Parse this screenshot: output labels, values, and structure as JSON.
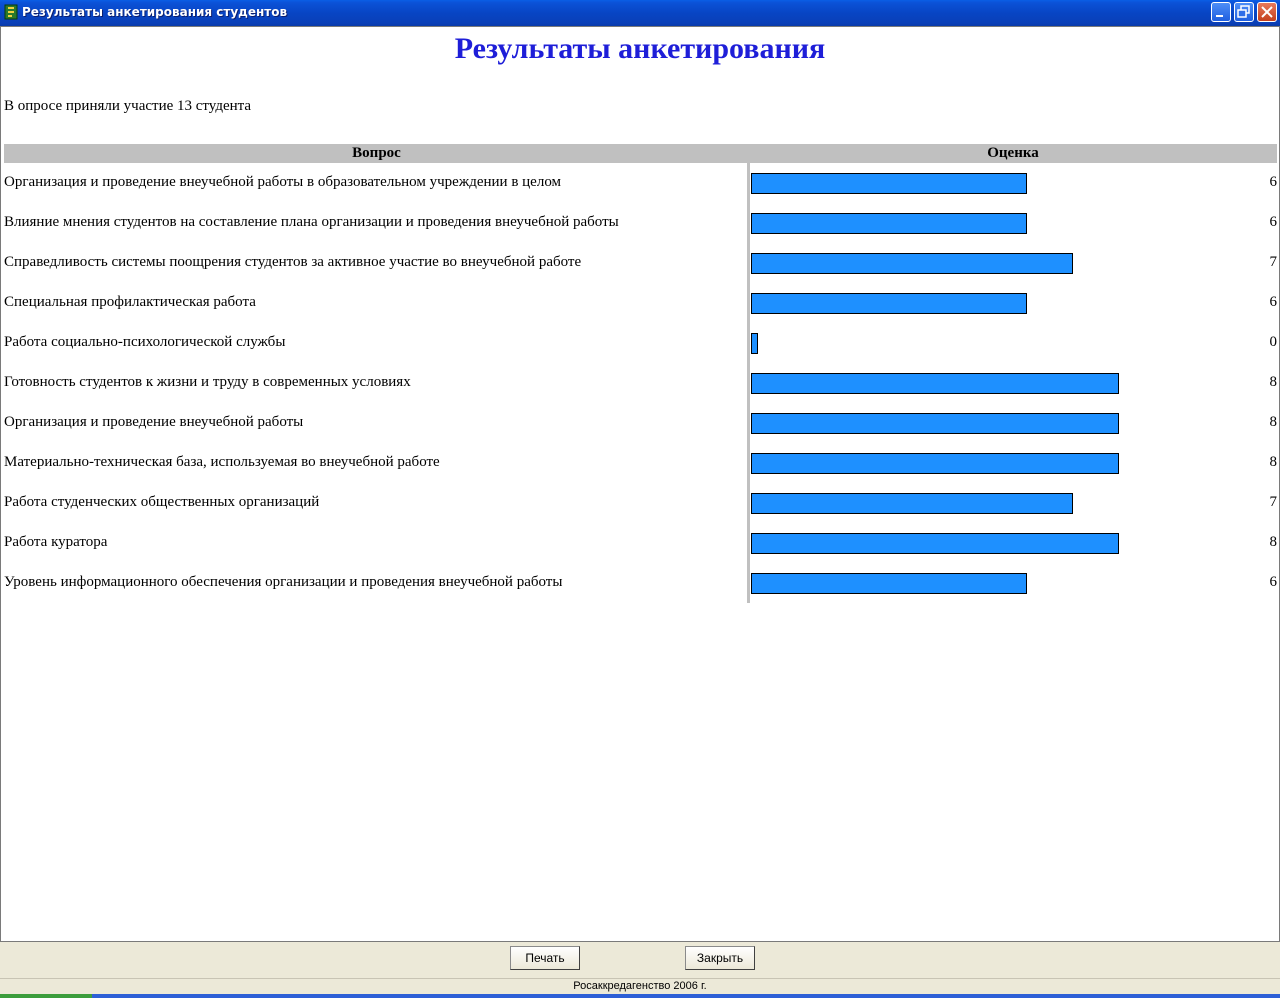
{
  "window": {
    "title": "Результаты анкетирования студентов"
  },
  "report": {
    "title": "Результаты анкетирования",
    "participants": "В опросе приняли участие 13 студента"
  },
  "table": {
    "header_question": "Вопрос",
    "header_score": "Оценка",
    "max_score": 8,
    "rows": [
      {
        "question": "Организация и проведение внеучебной работы в образовательном учреждении в целом",
        "value": 6
      },
      {
        "question": "Влияние мнения студентов на составление плана организации и проведения внеучебной работы",
        "value": 6
      },
      {
        "question": "Справедливость системы поощрения студентов за активное участие во внеучебной работе",
        "value": 7
      },
      {
        "question": "Специальная профилактическая работа",
        "value": 6
      },
      {
        "question": "Работа социально-психологической службы",
        "value": 0
      },
      {
        "question": "Готовность студентов к жизни и труду в современных условиях",
        "value": 8
      },
      {
        "question": "Организация и проведение внеучебной работы",
        "value": 8
      },
      {
        "question": "Материально-техническая база, используемая во внеучебной работе",
        "value": 8
      },
      {
        "question": "Работа студенческих общественных организаций",
        "value": 7
      },
      {
        "question": "Работа куратора",
        "value": 8
      },
      {
        "question": "Уровень информационного обеспечения организации и проведения внеучебной работы",
        "value": 6
      }
    ]
  },
  "buttons": {
    "print": "Печать",
    "close": "Закрыть"
  },
  "status": {
    "text": "Росаккредагенство 2006 г."
  },
  "colors": {
    "bar": "#1e90ff",
    "title": "#1e1ed8",
    "header_bg": "#c0c0c0"
  }
}
